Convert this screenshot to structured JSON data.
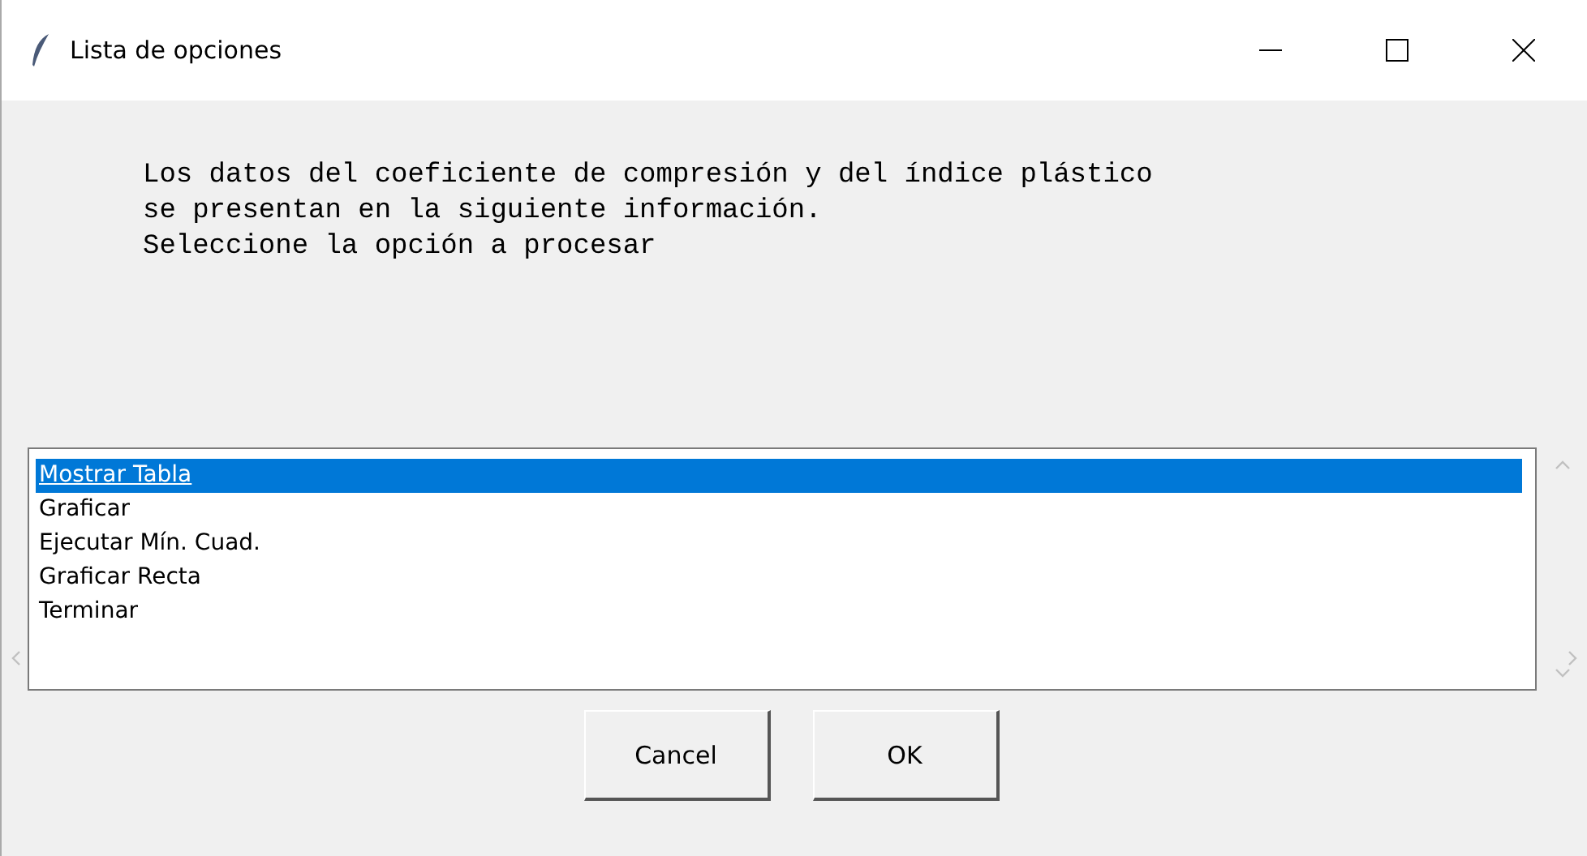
{
  "window": {
    "title": "Lista de opciones"
  },
  "message": [
    "Los datos del coeficiente de compresión y del índice plástico",
    "se presentan en la siguiente información.",
    "Seleccione la opción a procesar"
  ],
  "options": [
    {
      "label": "Mostrar Tabla",
      "selected": true
    },
    {
      "label": "Graficar",
      "selected": false
    },
    {
      "label": "Ejecutar Mín. Cuad.",
      "selected": false
    },
    {
      "label": "Graficar Recta",
      "selected": false
    },
    {
      "label": "Terminar",
      "selected": false
    }
  ],
  "buttons": [
    "Cancel",
    "OK"
  ]
}
